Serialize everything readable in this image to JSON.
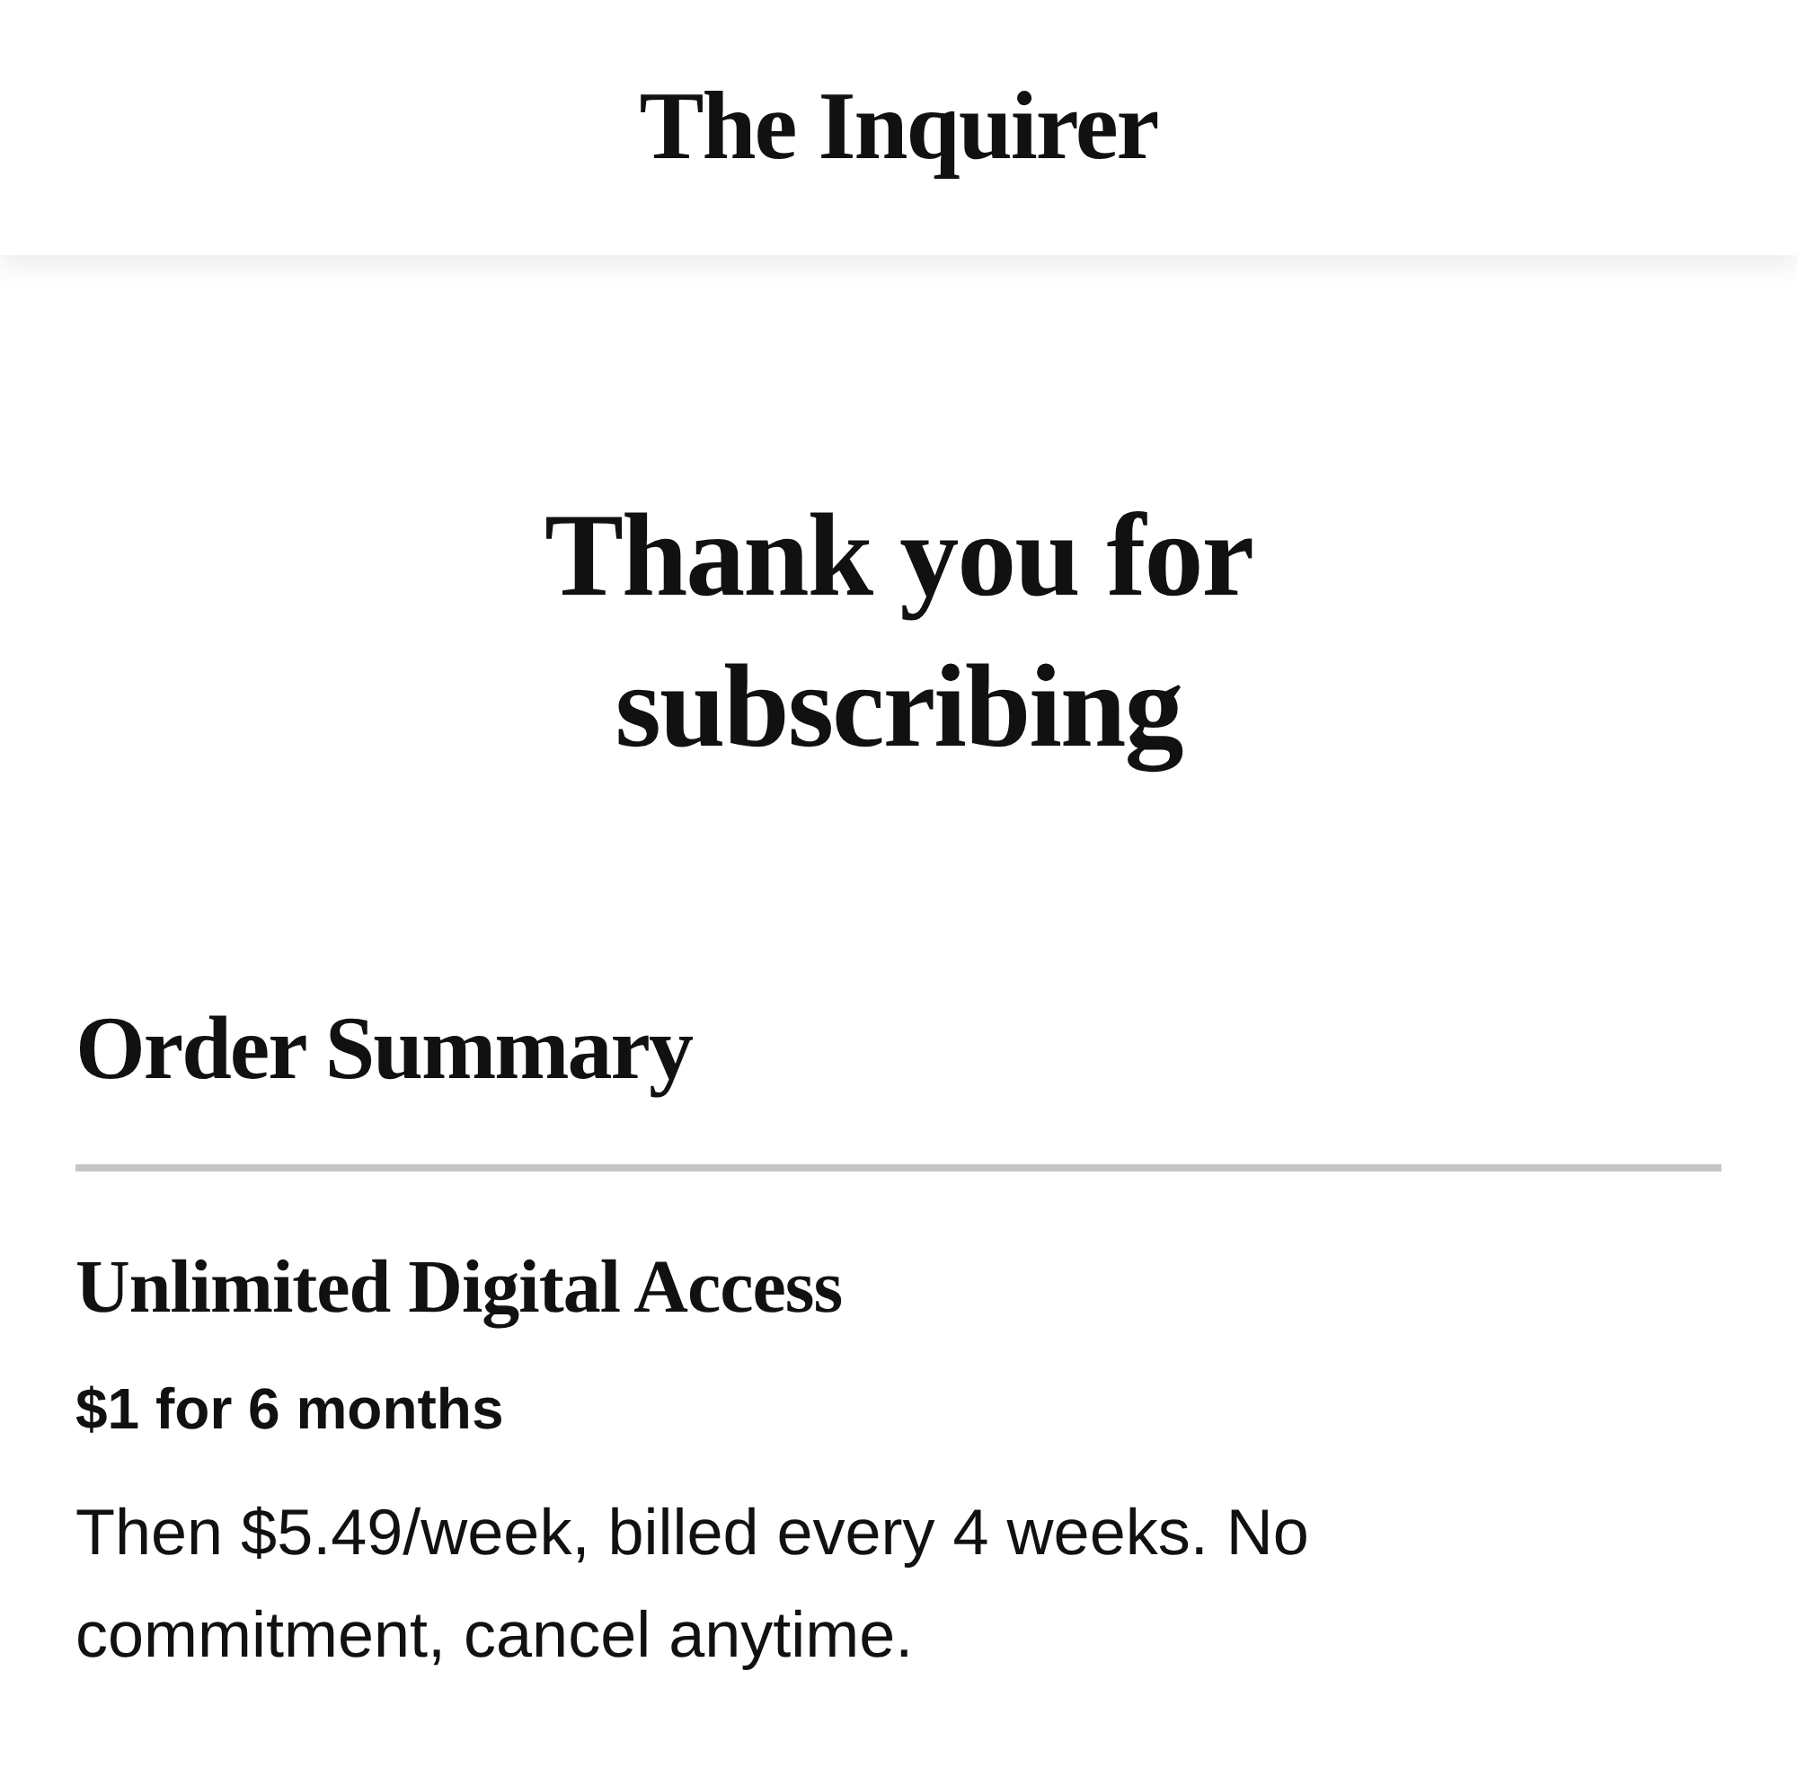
{
  "header": {
    "logo": "The Inquirer"
  },
  "confirmation": {
    "title": "Thank you for subscribing"
  },
  "order_summary": {
    "heading": "Order Summary",
    "plan": {
      "name": "Unlimited Digital Access",
      "price": "$1 for 6 months",
      "terms": "Then $5.49/week, billed every 4 weeks. No commitment, cancel anytime."
    }
  }
}
